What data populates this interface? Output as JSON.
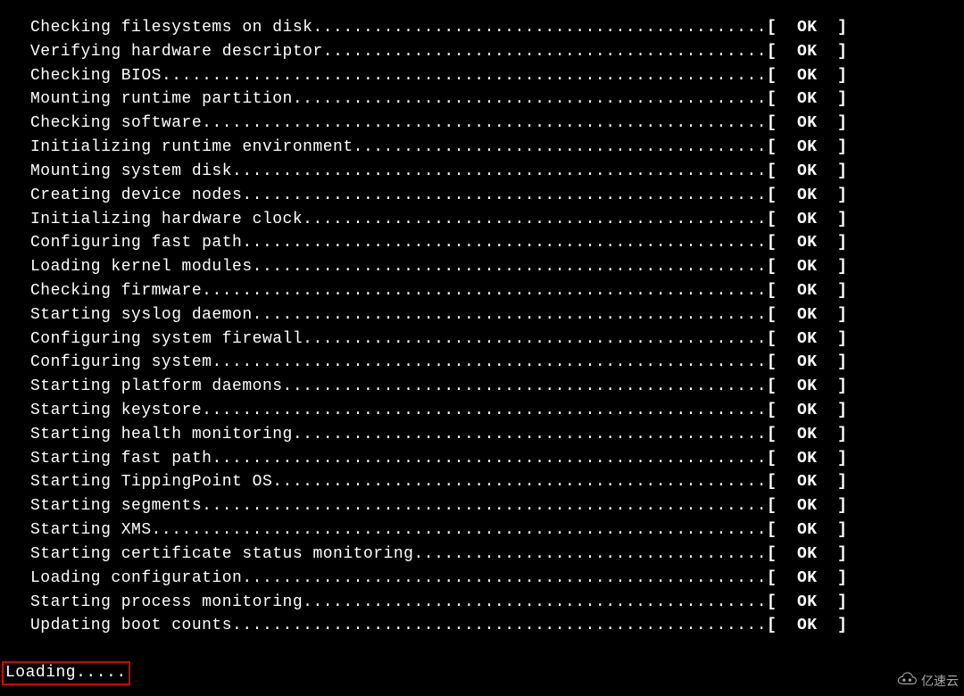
{
  "boot_steps": [
    {
      "msg": "Checking filesystems on disk",
      "status": "OK"
    },
    {
      "msg": "Verifying hardware descriptor",
      "status": "OK"
    },
    {
      "msg": "Checking BIOS",
      "status": "OK"
    },
    {
      "msg": "Mounting runtime partition",
      "status": "OK"
    },
    {
      "msg": "Checking software",
      "status": "OK"
    },
    {
      "msg": "Initializing runtime environment",
      "status": "OK"
    },
    {
      "msg": "Mounting system disk",
      "status": "OK"
    },
    {
      "msg": "Creating device nodes",
      "status": "OK"
    },
    {
      "msg": "Initializing hardware clock",
      "status": "OK"
    },
    {
      "msg": "Configuring fast path",
      "status": "OK"
    },
    {
      "msg": "Loading kernel modules",
      "status": "OK"
    },
    {
      "msg": "Checking firmware",
      "status": "OK"
    },
    {
      "msg": "Starting syslog daemon",
      "status": "OK"
    },
    {
      "msg": "Configuring system firewall",
      "status": "OK"
    },
    {
      "msg": "Configuring system",
      "status": "OK"
    },
    {
      "msg": "Starting platform daemons",
      "status": "OK"
    },
    {
      "msg": "Starting keystore",
      "status": "OK"
    },
    {
      "msg": "Starting health monitoring",
      "status": "OK"
    },
    {
      "msg": "Starting fast path",
      "status": "OK"
    },
    {
      "msg": "Starting TippingPoint OS",
      "status": "OK"
    },
    {
      "msg": "Starting segments",
      "status": "OK"
    },
    {
      "msg": "Starting XMS",
      "status": "OK"
    },
    {
      "msg": "Starting certificate status monitoring",
      "status": "OK"
    },
    {
      "msg": "Loading configuration",
      "status": "OK"
    },
    {
      "msg": "Starting process monitoring",
      "status": "OK"
    },
    {
      "msg": "Updating boot counts",
      "status": "OK"
    }
  ],
  "loading_text": "Loading.....",
  "line_total_chars": 84,
  "status_bracket_open": "[",
  "status_bracket_close": "]",
  "watermark_text": "亿速云"
}
